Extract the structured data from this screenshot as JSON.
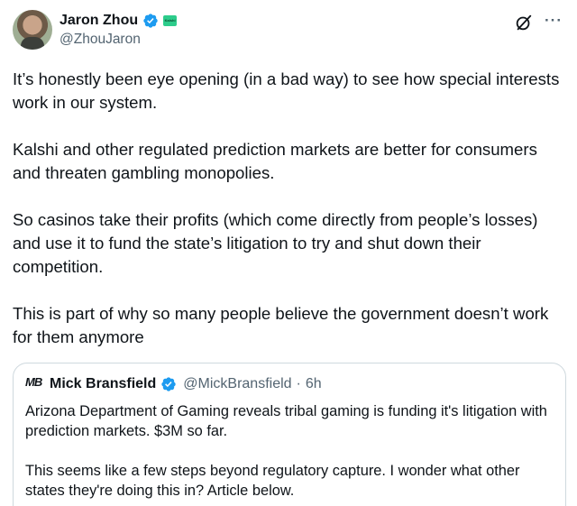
{
  "author": {
    "display_name": "Jaron Zhou",
    "handle": "@ZhouJaron",
    "affiliation_badge": "Kalshi",
    "avatar_icon": "person-avatar",
    "verified_color": "#1d9bf0",
    "affiliation_color": "#2dcc8b"
  },
  "actions": {
    "grok_icon": "grok-icon",
    "more_label": "···"
  },
  "tweet": {
    "paragraphs": [
      "It’s honestly been eye opening (in a bad way) to see how special interests work in our system.",
      "Kalshi and other regulated prediction markets are better for consumers and threaten gambling monopolies.",
      "So casinos take their profits (which come directly from people’s losses) and use it to fund the state’s litigation to try and shut down their competition.",
      "This is part of why so many people believe the government doesn’t work for them anymore"
    ]
  },
  "quote": {
    "avatar_text": "MB",
    "display_name": "Mick Bransfield",
    "handle": "@MickBransfield",
    "separator": "·",
    "time": "6h",
    "paragraphs": [
      "Arizona Department of Gaming reveals tribal gaming is funding it's litigation with prediction markets. $3M so far.",
      "This seems like a few steps beyond regulatory capture. I wonder what other states they're doing this in? Article below."
    ]
  }
}
